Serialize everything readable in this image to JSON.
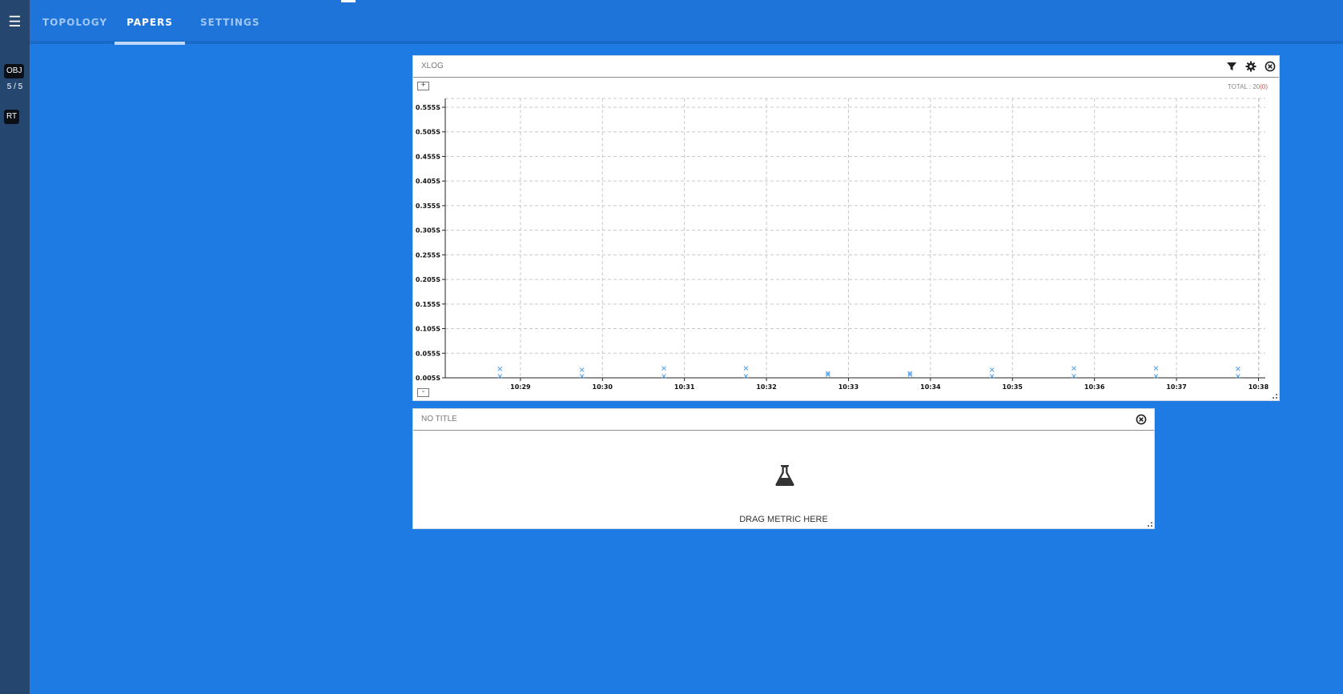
{
  "nav": {
    "menu_icon": "hamburger-icon",
    "tabs": [
      {
        "label": "TOPOLOGY",
        "active": false
      },
      {
        "label": "PAPERS",
        "active": true
      },
      {
        "label": "SETTINGS",
        "active": false
      }
    ]
  },
  "sidebar": {
    "obj_label": "OBJ",
    "obj_count": "5 / 5",
    "rt_label": "RT"
  },
  "xlog_panel": {
    "title": "XLOG",
    "icons": [
      "filter-icon",
      "gear-icon",
      "close-icon"
    ],
    "zoom_in": "+",
    "zoom_out": "-",
    "total_label": "TOTAL : 20",
    "error_count": "(0)",
    "point_color": "#5da6e8"
  },
  "metric_panel": {
    "title": "NO TITLE",
    "icons": [
      "close-icon"
    ],
    "drop_text": "DRAG METRIC HERE",
    "drop_icon": "flask-icon"
  },
  "chart_data": {
    "type": "scatter",
    "title": "",
    "xlabel": "",
    "ylabel": "",
    "x_ticks": [
      "10:29",
      "10:30",
      "10:31",
      "10:32",
      "10:33",
      "10:34",
      "10:35",
      "10:36",
      "10:37",
      "10:38"
    ],
    "y_ticks": [
      "0.005S",
      "0.055S",
      "0.105S",
      "0.155S",
      "0.205S",
      "0.255S",
      "0.305S",
      "0.355S",
      "0.405S",
      "0.455S",
      "0.505S",
      "0.555S"
    ],
    "x_range": [
      "10:28:05",
      "10:38:05"
    ],
    "ylim": [
      0.005,
      0.555
    ],
    "grid": true,
    "series": [
      {
        "points": [
          {
            "x": "10:28:45",
            "y": 0.02
          },
          {
            "x": "10:28:45",
            "y": 0.005
          },
          {
            "x": "10:29:45",
            "y": 0.018
          },
          {
            "x": "10:29:45",
            "y": 0.005
          },
          {
            "x": "10:30:45",
            "y": 0.021
          },
          {
            "x": "10:30:45",
            "y": 0.005
          },
          {
            "x": "10:31:45",
            "y": 0.021
          },
          {
            "x": "10:31:45",
            "y": 0.005
          },
          {
            "x": "10:32:45",
            "y": 0.011
          },
          {
            "x": "10:32:45",
            "y": 0.008
          },
          {
            "x": "10:33:45",
            "y": 0.011
          },
          {
            "x": "10:33:45",
            "y": 0.008
          },
          {
            "x": "10:34:45",
            "y": 0.018
          },
          {
            "x": "10:34:45",
            "y": 0.005
          },
          {
            "x": "10:35:45",
            "y": 0.021
          },
          {
            "x": "10:35:45",
            "y": 0.005
          },
          {
            "x": "10:36:45",
            "y": 0.021
          },
          {
            "x": "10:36:45",
            "y": 0.005
          },
          {
            "x": "10:37:45",
            "y": 0.02
          },
          {
            "x": "10:37:45",
            "y": 0.005
          }
        ]
      }
    ]
  }
}
